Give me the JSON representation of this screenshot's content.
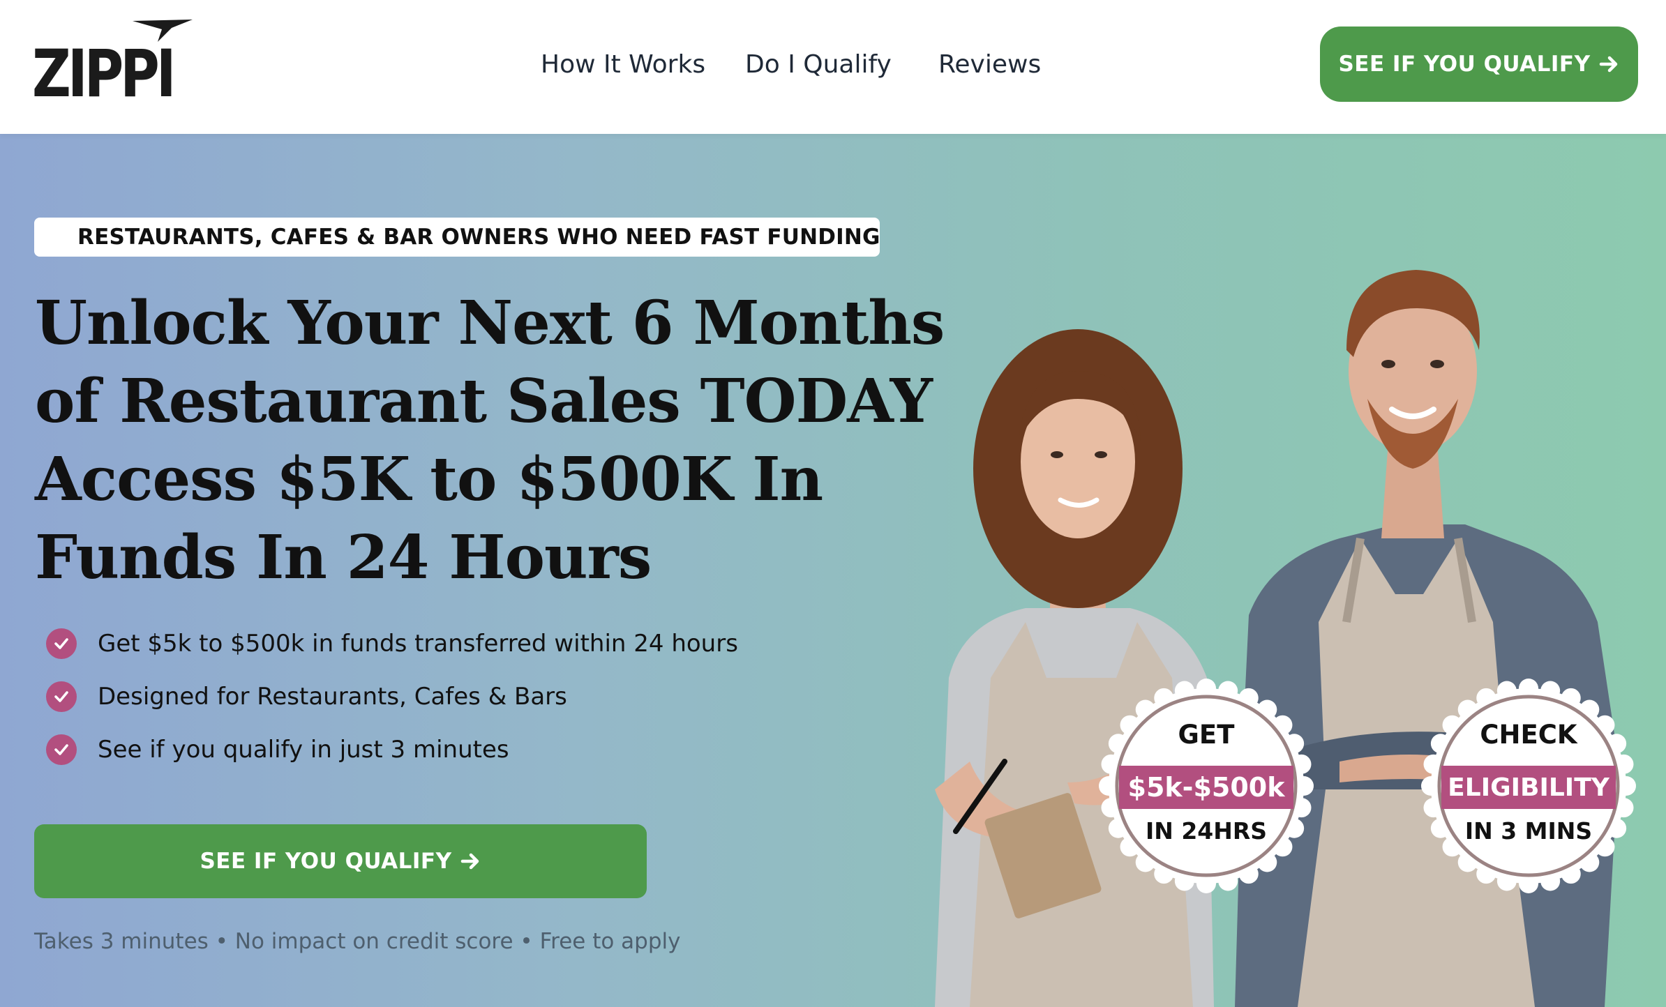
{
  "header": {
    "logo_text": "ZIPPI",
    "nav": [
      {
        "label": "How It Works"
      },
      {
        "label": "Do I Qualify"
      },
      {
        "label": "Reviews"
      }
    ],
    "cta_label": "SEE IF YOU QUALIFY",
    "cta_icon": "arrow-right-icon"
  },
  "hero": {
    "tagline": "RESTAURANTS, CAFES & BAR OWNERS WHO NEED FAST FUNDING",
    "tagline_icon": "us-flag-icon",
    "headline": [
      "Unlock Your Next 6 Months",
      "of Restaurant Sales TODAY",
      "Access $5K to $500K In",
      "Funds In 24 Hours"
    ],
    "benefits": [
      "Get $5k to $500k in funds transferred within 24 hours",
      "Designed for Restaurants, Cafes & Bars",
      "See if you qualify in just 3 minutes"
    ],
    "cta_label": "SEE IF YOU QUALIFY",
    "fineprint": "Takes 3 minutes • No impact on credit score • Free to apply"
  },
  "badges": [
    {
      "top": "GET",
      "pill": "$5k-$500k",
      "bottom": "IN 24HRS"
    },
    {
      "top": "CHECK",
      "pill": "ELIGIBILITY",
      "bottom": "IN 3 MINS"
    }
  ],
  "colors": {
    "brand_green": "#4e9a4b",
    "accent_magenta": "#b24f7f",
    "text_dark": "#111111"
  }
}
